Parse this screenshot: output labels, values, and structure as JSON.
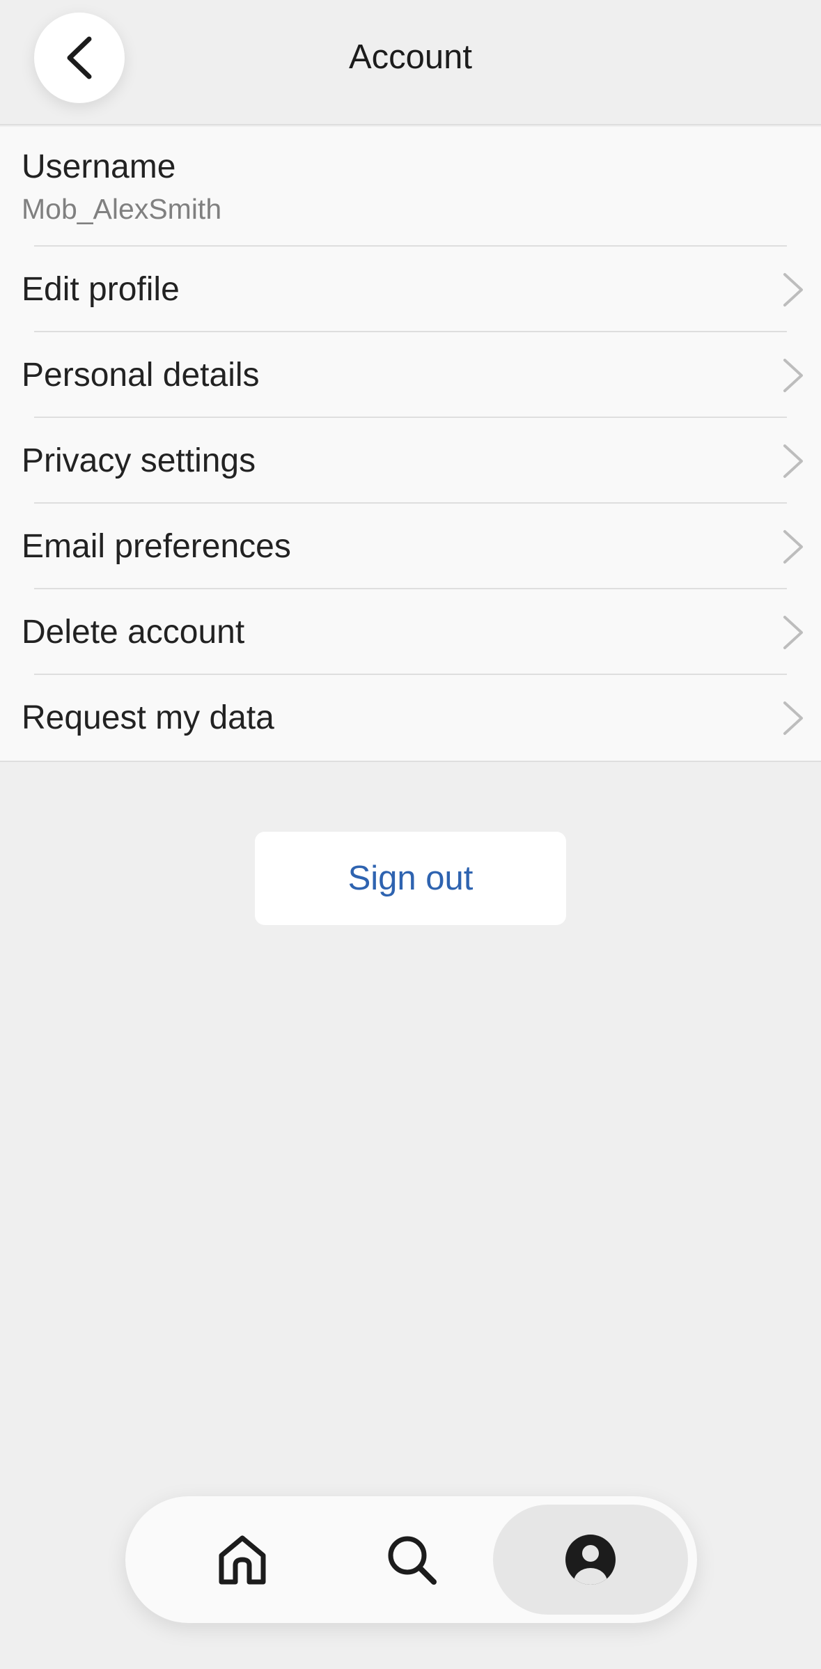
{
  "header": {
    "title": "Account",
    "back_icon": "chevron-left-icon"
  },
  "username": {
    "label": "Username",
    "value": "Mob_AlexSmith"
  },
  "menu": {
    "items": [
      {
        "label": "Edit profile"
      },
      {
        "label": "Personal details"
      },
      {
        "label": "Privacy settings"
      },
      {
        "label": "Email preferences"
      },
      {
        "label": "Delete account"
      },
      {
        "label": "Request my data"
      }
    ]
  },
  "signout": {
    "label": "Sign out",
    "color": "#2e63b0"
  },
  "tabbar": {
    "tabs": [
      {
        "icon": "home-icon",
        "active": false
      },
      {
        "icon": "search-icon",
        "active": false
      },
      {
        "icon": "profile-icon",
        "active": true
      }
    ]
  }
}
